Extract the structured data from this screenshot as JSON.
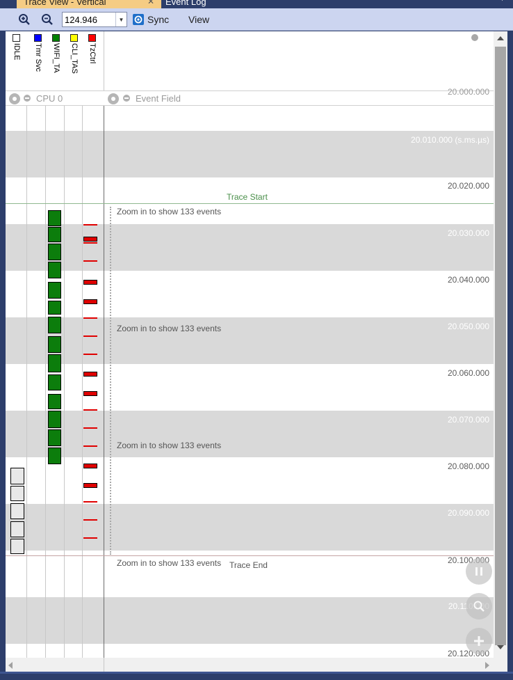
{
  "tabs": [
    {
      "label": "Trace View - Vertical",
      "active": true
    },
    {
      "label": "Event Log",
      "active": false
    }
  ],
  "toolbar": {
    "zoom_value": "124.946",
    "sync_label": "Sync",
    "view_label": "View",
    "zoom_in_icon": "zoom-in-icon",
    "zoom_out_icon": "zoom-out-icon"
  },
  "actors": [
    {
      "name": "IDLE",
      "color": "#ffffff"
    },
    {
      "name": "Tmr Svc",
      "color": "#0000ff"
    },
    {
      "name": "WIFI_TA",
      "color": "#008000"
    },
    {
      "name": "CLI_TAS",
      "color": "#ffff00"
    },
    {
      "name": "TzCtrl",
      "color": "#ff0000"
    }
  ],
  "columns": {
    "cpu_label": "CPU 0",
    "event_field_label": "Event Field"
  },
  "timestamps": {
    "t0": "20.000.000",
    "t1": "20.010.000 (s.ms.µs)",
    "t2": "20.020.000",
    "t3": "20.030.000",
    "t4": "20.040.000",
    "t5": "20.050.000",
    "t6": "20.060.000",
    "t7": "20.070.000",
    "t8": "20.080.000",
    "t9": "20.090.000",
    "t10": "20.100.000",
    "t11": "20.110.000",
    "t12": "20.120.000"
  },
  "markers": {
    "start": "Trace Start",
    "end": "Trace End",
    "start_color": "#4a8f4a",
    "end_color": "#8a4040"
  },
  "zoom_notes": {
    "n1": "Zoom in to show 133 events",
    "n2": "Zoom in to show 133 events",
    "n3": "Zoom in to show 133 events",
    "n4": "Zoom in to show 133 events"
  },
  "colors": {
    "window_bg": "#2d3e6b",
    "toolbar_bg": "#ccd5f0",
    "active_tab": "#f5cc84",
    "band": "#d9d9d9",
    "task_green": "#0c7d0c",
    "task_red": "#e00000"
  }
}
